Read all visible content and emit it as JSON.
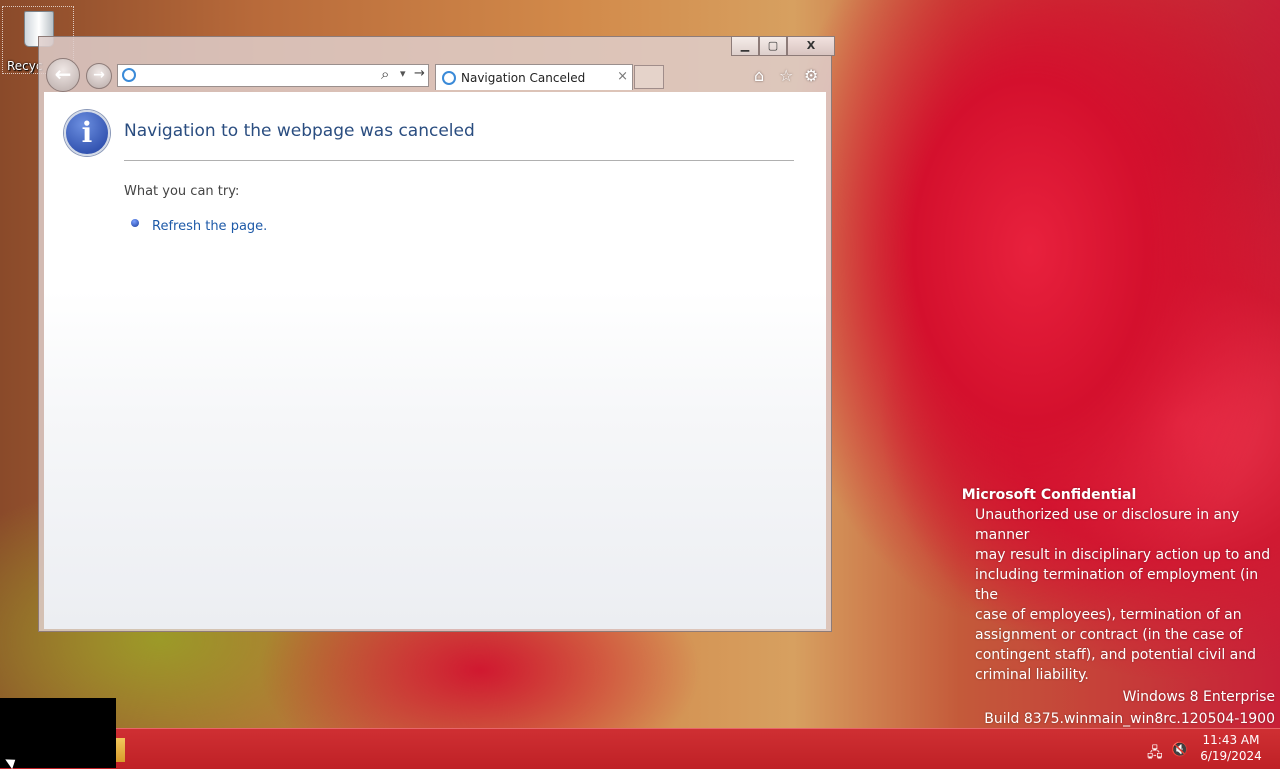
{
  "desktop": {
    "recycle_label": "Recyc"
  },
  "browser": {
    "caption": {
      "minimize": "▁",
      "maximize": "▢",
      "close": "X"
    },
    "address": {
      "value": "",
      "search_icon": "⌕",
      "dropdown": "▾",
      "go": "→"
    },
    "tab": {
      "title": "Navigation Canceled",
      "close": "×"
    },
    "toolbar_icons": {
      "home": "⌂",
      "favorites": "☆",
      "tools": "⚙"
    },
    "page": {
      "heading": "Navigation to the webpage was canceled",
      "try_label": "What you can try:",
      "suggestion": "Refresh the page."
    }
  },
  "watermark": {
    "title": "Microsoft Confidential",
    "lines": [
      "Unauthorized use or disclosure in any manner",
      "may result in disciplinary action up to and",
      "including termination of employment (in the",
      "case of employees), termination of an",
      "assignment or contract (in the case of",
      "contingent staff), and potential civil and",
      "criminal liability."
    ],
    "edition": "Windows 8 Enterprise",
    "build": "Build 8375.winmain_win8rc.120504-1900"
  },
  "taskbar": {
    "time": "11:43 AM",
    "date": "6/19/2024",
    "network_icon": "🖧",
    "volume_icon": "🔇"
  }
}
